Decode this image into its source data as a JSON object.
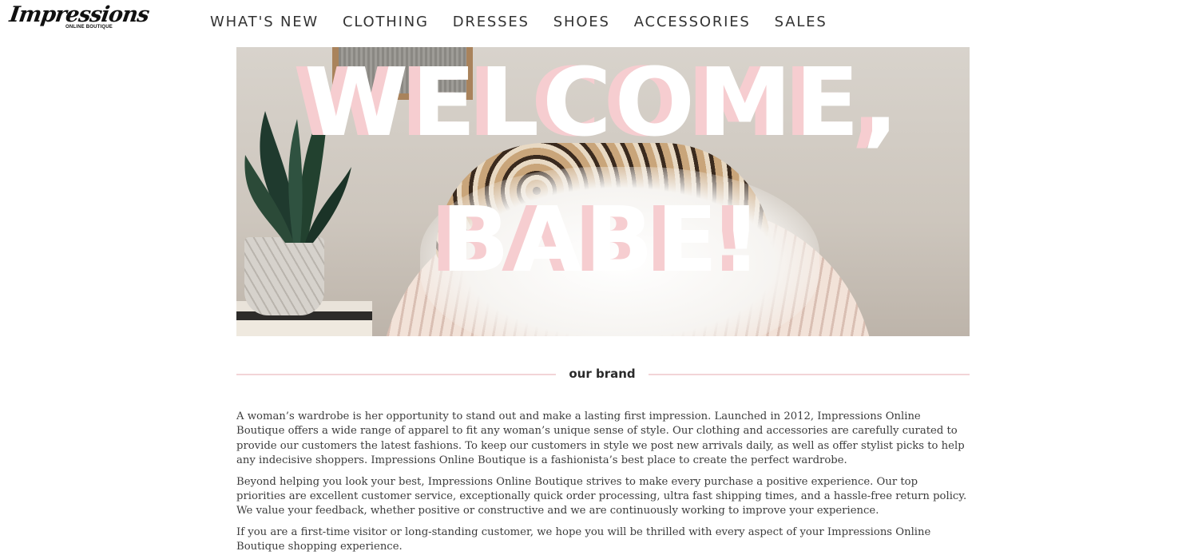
{
  "brand": {
    "logo_text": "Impressions",
    "logo_subtext": "ONLINE BOUTIQUE"
  },
  "nav": {
    "items": [
      {
        "label": "WHAT'S NEW"
      },
      {
        "label": "CLOTHING"
      },
      {
        "label": "DRESSES"
      },
      {
        "label": "SHOES"
      },
      {
        "label": "ACCESSORIES"
      },
      {
        "label": "SALES"
      }
    ]
  },
  "hero": {
    "line1": "WELCOME,",
    "line2": "BABE!",
    "accent_color": "#f6cdd0"
  },
  "our_brand": {
    "heading": "our brand",
    "paragraphs": [
      "A woman’s wardrobe is her opportunity to stand out and make a lasting first impression. Launched in 2012, Impressions Online Boutique offers a wide range of apparel to fit any woman’s unique sense of style. Our clothing and accessories are carefully curated to provide our customers the latest fashions. To keep our customers in style we post new arrivals daily, as well as offer stylist picks to help any indecisive shoppers. Impressions Online Boutique is a fashionista’s best place to create the perfect wardrobe.",
      "Beyond helping you look your best, Impressions Online Boutique strives to make every purchase a positive experience. Our top priorities are excellent customer service, exceptionally quick order processing, ultra fast shipping times, and a hassle-free return policy. We value your feedback, whether positive or constructive and we are continuously working to improve your experience.",
      "If you are a first-time visitor or long-standing customer, we hope you will be thrilled with every aspect of your Impressions Online Boutique shopping experience."
    ]
  }
}
